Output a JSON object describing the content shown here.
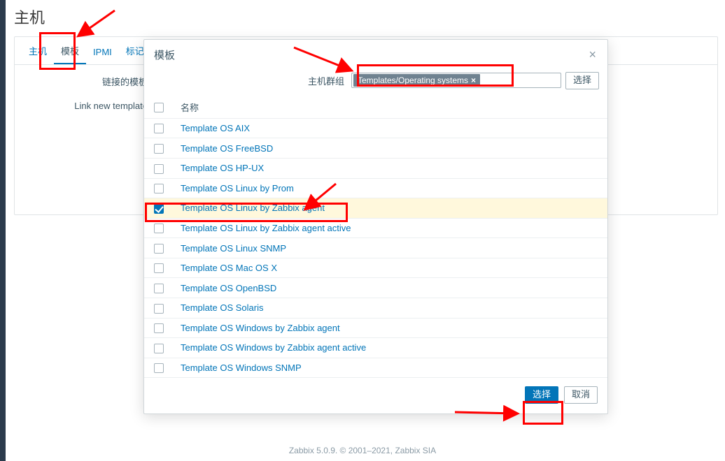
{
  "page": {
    "title": "主机"
  },
  "tabs": [
    {
      "label": "主机",
      "active": false
    },
    {
      "label": "模板",
      "active": true
    },
    {
      "label": "IPMI",
      "active": false
    },
    {
      "label": "标记",
      "active": false
    }
  ],
  "form": {
    "linked_templates_label": "链接的模板",
    "link_new_label": "Link new template"
  },
  "modal": {
    "title": "模板",
    "close": "×",
    "filter_label": "主机群组",
    "filter_tag": "Templates/Operating systems",
    "filter_tag_x": "×",
    "select_btn": "选择",
    "header_name": "名称",
    "rows": [
      {
        "name": "Template OS AIX",
        "checked": false
      },
      {
        "name": "Template OS FreeBSD",
        "checked": false
      },
      {
        "name": "Template OS HP-UX",
        "checked": false
      },
      {
        "name": "Template OS Linux by Prom",
        "checked": false
      },
      {
        "name": "Template OS Linux by Zabbix agent",
        "checked": true
      },
      {
        "name": "Template OS Linux by Zabbix agent active",
        "checked": false
      },
      {
        "name": "Template OS Linux SNMP",
        "checked": false
      },
      {
        "name": "Template OS Mac OS X",
        "checked": false
      },
      {
        "name": "Template OS OpenBSD",
        "checked": false
      },
      {
        "name": "Template OS Solaris",
        "checked": false
      },
      {
        "name": "Template OS Windows by Zabbix agent",
        "checked": false
      },
      {
        "name": "Template OS Windows by Zabbix agent active",
        "checked": false
      },
      {
        "name": "Template OS Windows SNMP",
        "checked": false
      }
    ],
    "footer_select": "选择",
    "footer_cancel": "取消"
  },
  "footer": {
    "text_prefix": "Zabbix 5.0.9. © 2001–2021, ",
    "link": "Zabbix SIA"
  }
}
